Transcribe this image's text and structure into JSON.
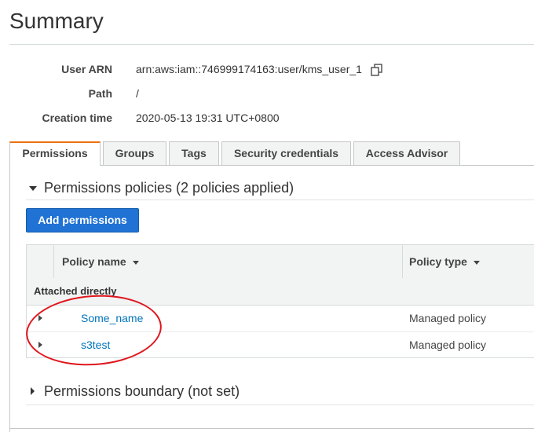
{
  "page": {
    "title": "Summary"
  },
  "summary": {
    "user_arn_label": "User ARN",
    "user_arn_value": "arn:aws:iam::746999174163:user/kms_user_1",
    "path_label": "Path",
    "path_value": "/",
    "creation_label": "Creation time",
    "creation_value": "2020-05-13 19:31 UTC+0800",
    "copy_icon": "copy-icon"
  },
  "tabs": [
    {
      "label": "Permissions",
      "active": true
    },
    {
      "label": "Groups",
      "active": false
    },
    {
      "label": "Tags",
      "active": false
    },
    {
      "label": "Security credentials",
      "active": false
    },
    {
      "label": "Access Advisor",
      "active": false
    }
  ],
  "policies_section": {
    "title": "Permissions policies (2 policies applied)",
    "expanded": true,
    "add_button": "Add permissions"
  },
  "table": {
    "col_policy_name": "Policy name",
    "col_policy_type": "Policy type",
    "group_label": "Attached directly",
    "rows": [
      {
        "name": "Some_name",
        "type": "Managed policy"
      },
      {
        "name": "s3test",
        "type": "Managed policy"
      }
    ]
  },
  "boundary_section": {
    "title": "Permissions boundary (not set)",
    "expanded": false
  },
  "colors": {
    "accent_tab": "#ec7211",
    "primary_button": "#2072d4",
    "link": "#0073bb",
    "annotation": "#e0161d"
  }
}
